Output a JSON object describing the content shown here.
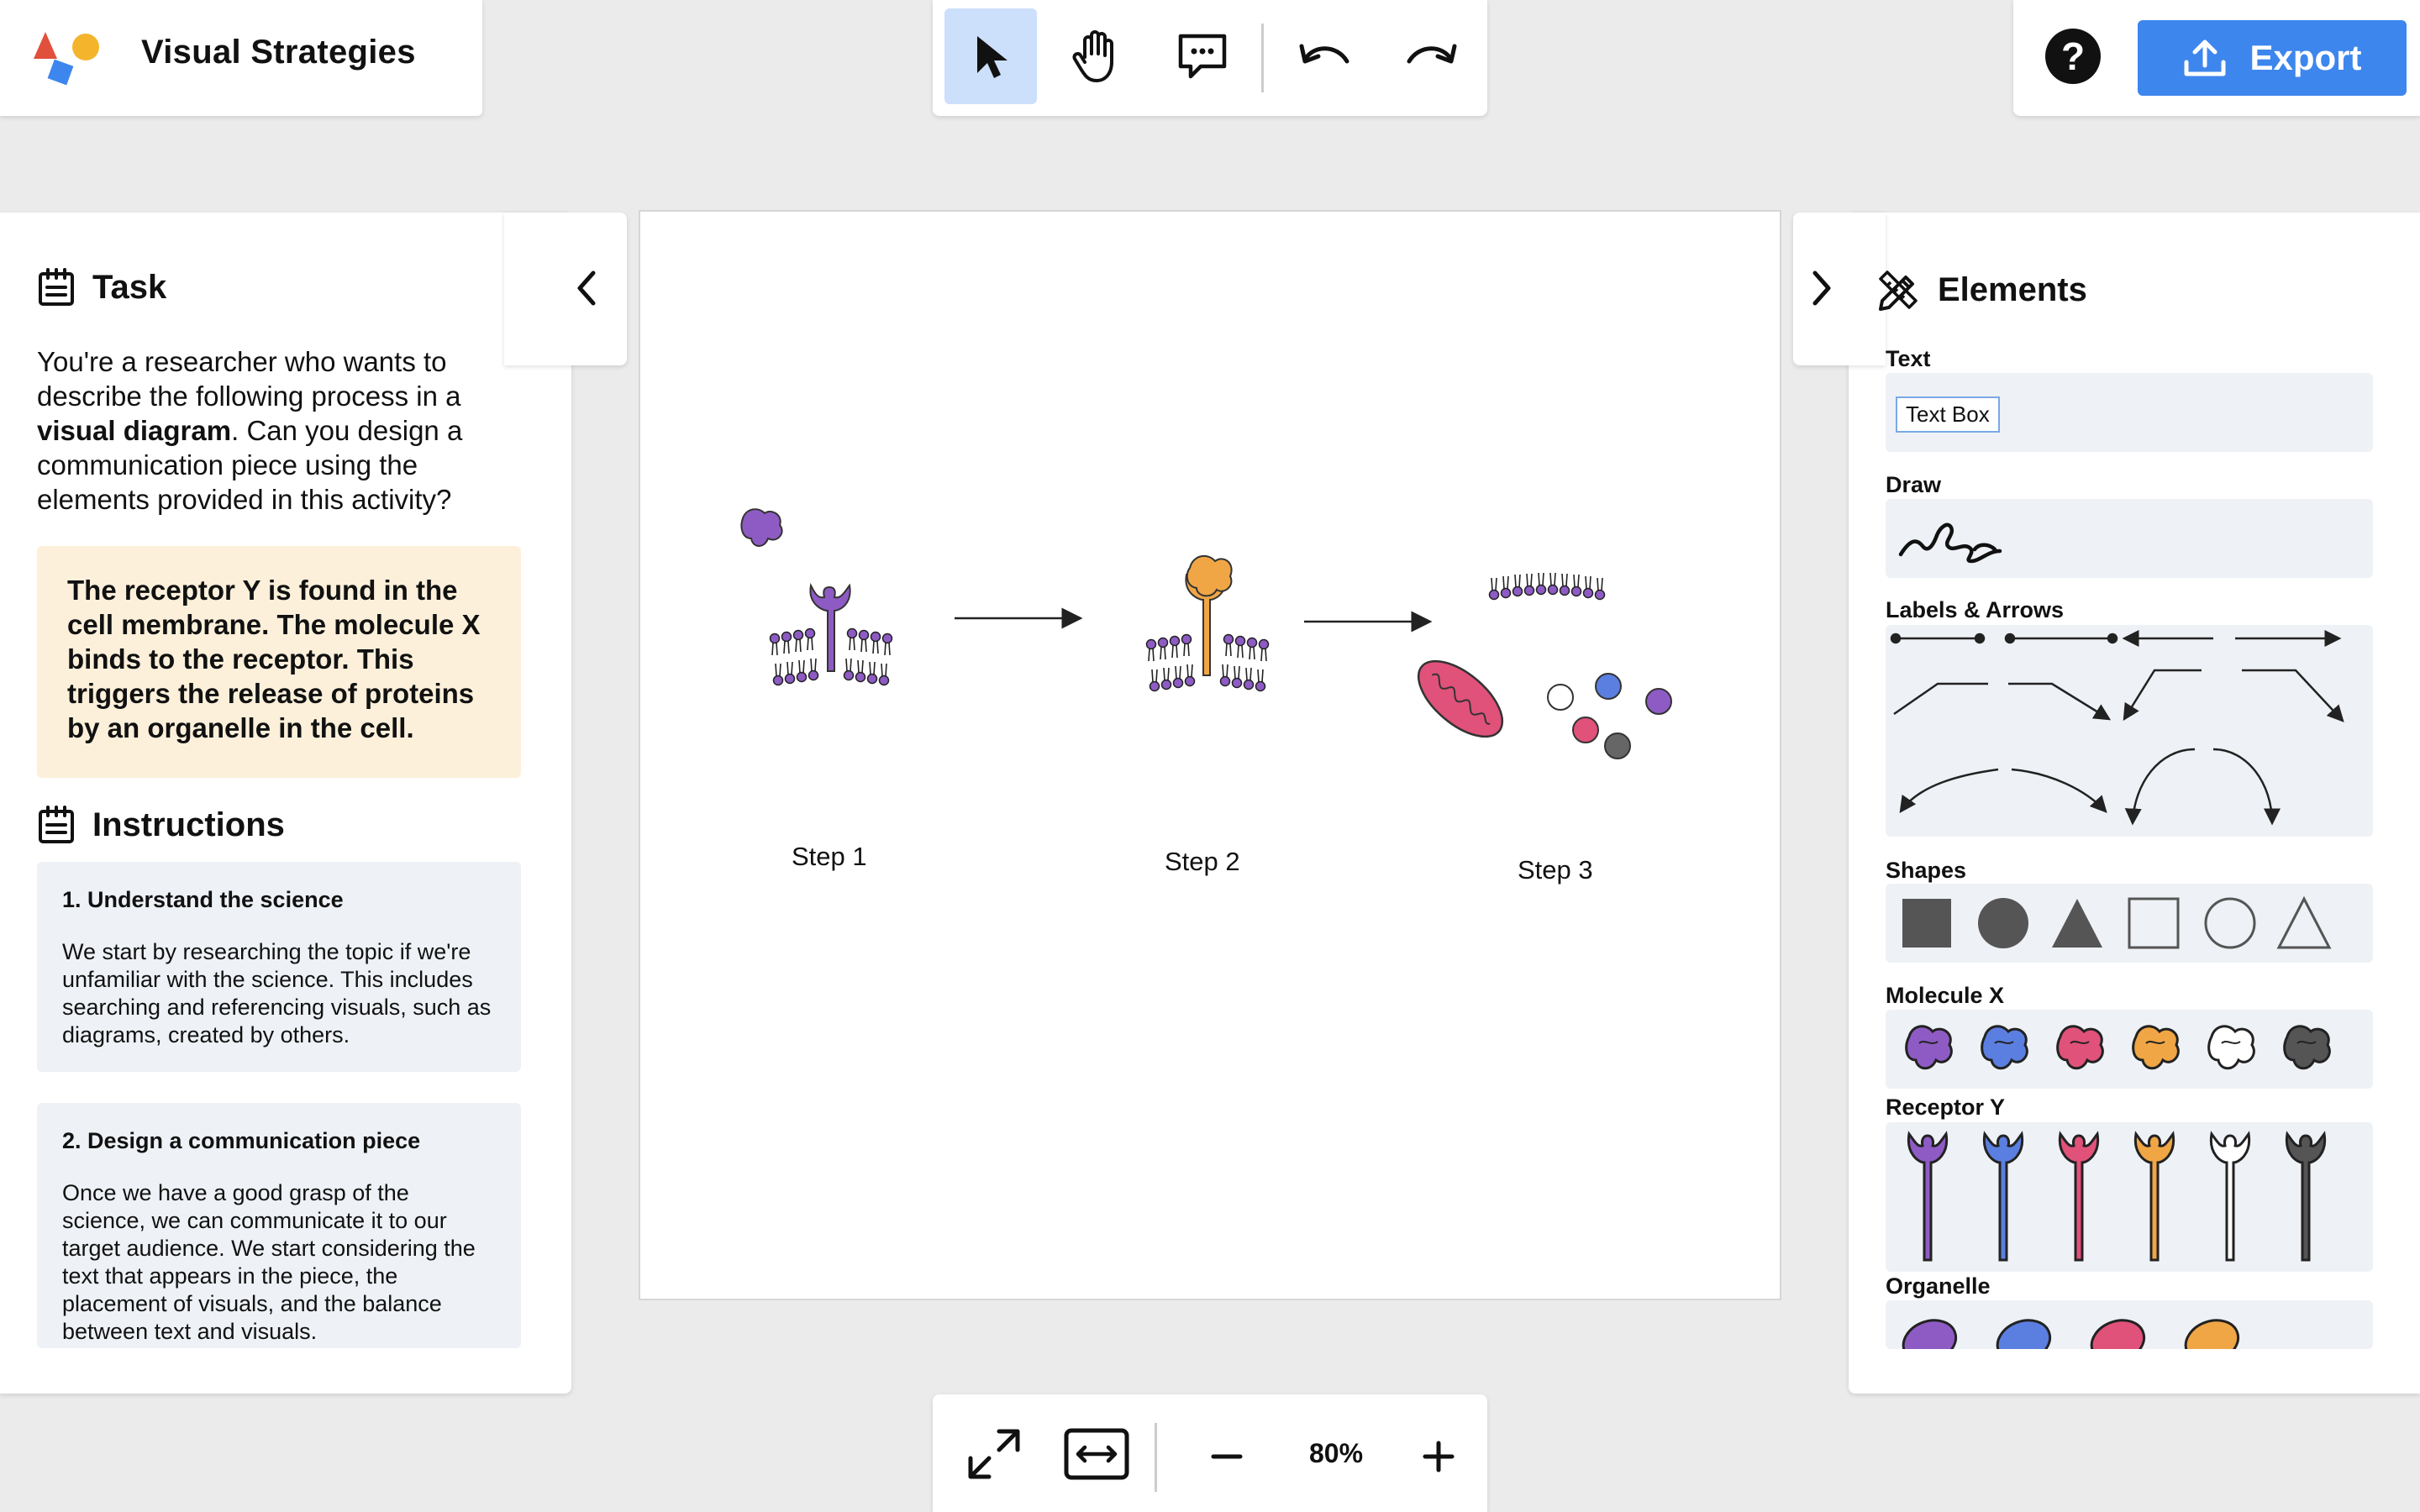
{
  "app": {
    "title": "Visual Strategies"
  },
  "toolbar": {
    "tools": [
      "select-tool",
      "pan-tool",
      "comment-tool",
      "undo",
      "redo"
    ],
    "active_tool": "select-tool"
  },
  "topright": {
    "help_label": "?",
    "export_label": "Export"
  },
  "task": {
    "heading": "Task",
    "intro_1": "You're a researcher who wants to describe the following process in a ",
    "intro_bold": "visual diagram",
    "intro_2": ". Can you design a communication piece using the elements provided in this activity?",
    "highlight": "The receptor Y is found in the cell membrane. The molecule X binds to the receptor. This triggers the release of proteins by an organelle in the cell."
  },
  "instructions": {
    "heading": "Instructions",
    "items": [
      {
        "title": "1. Understand the science",
        "body": "We start by researching the topic if we're unfamiliar with the science. This includes searching and referencing visuals, such as diagrams, created by others."
      },
      {
        "title": "2. Design a communication piece",
        "body": "Once we have a good grasp of the science, we can communicate it to our target audience. We start considering the text that appears in the piece, the placement of visuals, and the balance between text and visuals."
      }
    ]
  },
  "canvas": {
    "steps": [
      "Step 1",
      "Step 2",
      "Step 3"
    ]
  },
  "elements": {
    "heading": "Elements",
    "sections": {
      "text": "Text",
      "text_box": "Text Box",
      "draw": "Draw",
      "labels_arrows": "Labels & Arrows",
      "shapes": "Shapes",
      "molecule": "Molecule X",
      "receptor": "Receptor Y",
      "organelle": "Organelle"
    },
    "colors": [
      "#8e5bc4",
      "#5b7fe0",
      "#e0527a",
      "#f0a645",
      "#ffffff",
      "#555555"
    ]
  },
  "zoom": {
    "level": "80%"
  }
}
